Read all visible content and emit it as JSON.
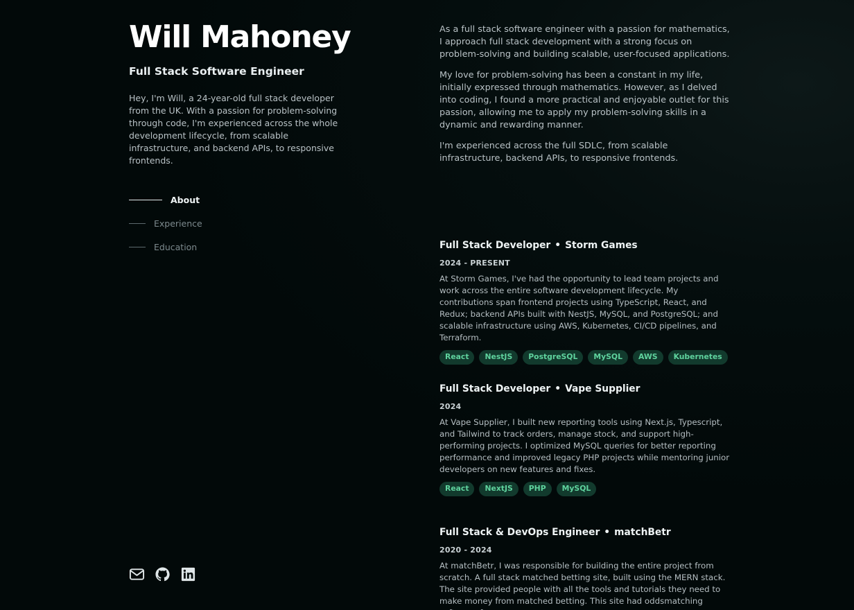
{
  "profile": {
    "name": "Will Mahoney",
    "subtitle": "Full Stack Software Engineer",
    "intro": "Hey, I'm Will, a 24-year-old full stack developer from the UK. With a passion for problem-solving through code, I'm experienced across the whole development lifecycle, from scalable infrastructure, and backend APIs, to responsive frontends."
  },
  "nav": [
    {
      "label": "About",
      "active": true
    },
    {
      "label": "Experience",
      "active": false
    },
    {
      "label": "Education",
      "active": false
    }
  ],
  "socials": [
    {
      "icon": "mail-icon"
    },
    {
      "icon": "github-icon"
    },
    {
      "icon": "linkedin-icon"
    }
  ],
  "about": [
    "As a full stack software engineer with a passion for mathematics, I approach full stack development with a strong focus on problem-solving and building scalable, user-focused applications.",
    "My love for problem-solving has been a constant in my life, initially expressed through mathematics. However, as I delved into coding, I found a more practical and enjoyable outlet for this passion, allowing me to apply my problem-solving skills in a dynamic and rewarding manner.",
    "I'm experienced across the full SDLC, from scalable infrastructure, backend APIs, to responsive frontends."
  ],
  "experience": [
    {
      "role": "Full Stack Developer",
      "company": "Storm Games",
      "date": "2024 - PRESENT",
      "desc": "At Storm Games, I've had the opportunity to lead team projects and work across the entire software development lifecycle. My contributions span frontend projects using TypeScript, React, and Redux; backend APIs built with NestJS, MySQL, and PostgreSQL; and scalable infrastructure using AWS, Kubernetes, CI/CD pipelines, and Terraform.",
      "tags": [
        "React",
        "NestJS",
        "PostgreSQL",
        "MySQL",
        "AWS",
        "Kubernetes"
      ]
    },
    {
      "role": "Full Stack Developer",
      "company": "Vape Supplier",
      "date": "2024",
      "desc": "At Vape Supplier, I built new reporting tools using Next.js, Typescript, and Tailwind to track orders, manage stock, and support high-performing projects. I optimized MySQL queries for better reporting performance and improved legacy PHP projects while mentoring junior developers on new features and fixes.",
      "tags": [
        "React",
        "NextJS",
        "PHP",
        "MySQL"
      ]
    },
    {
      "role": "Full Stack & DevOps Engineer",
      "company": "matchBetr",
      "date": "2020 - 2024",
      "desc": "At matchBetr, I was responsible for building the entire project from scratch. A full stack matched betting site, built using the MERN stack. The site provided people with all the tools and tutorials they need to make money from matched betting. This site had oddsmatching software, forums, a",
      "tags": []
    }
  ],
  "colors": {
    "background": "#020a0a",
    "tag_bg": "#123a2d",
    "tag_text": "#5fd39e"
  }
}
